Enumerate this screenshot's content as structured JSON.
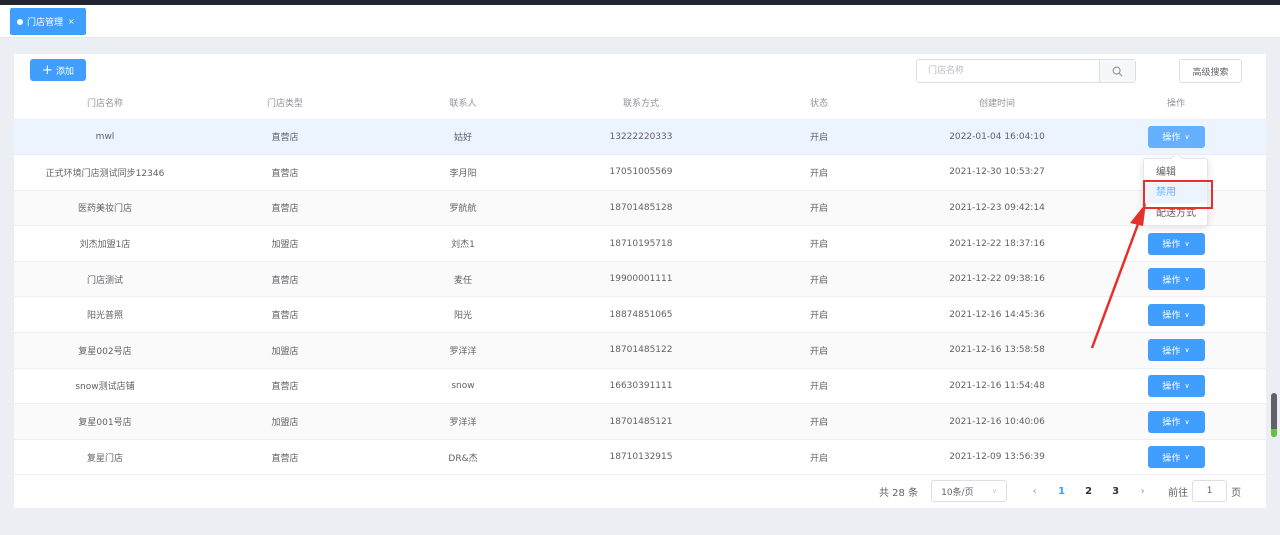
{
  "tab": {
    "label": "门店管理",
    "close": "×"
  },
  "toolbar": {
    "add_label": "添加",
    "add_icon": "+",
    "search_placeholder": "门店名称",
    "advanced_label": "高级搜索"
  },
  "table": {
    "headers": [
      "门店名称",
      "门店类型",
      "联系人",
      "联系方式",
      "状态",
      "创建时间",
      "操作"
    ],
    "action_label": "操作",
    "action_chevron": "∨",
    "rows": [
      {
        "name": "mwl",
        "type": "直营店",
        "contact": "姑好",
        "phone": "13222220333",
        "status": "开启",
        "created": "2022-01-04 16:04:10"
      },
      {
        "name": "正式环境门店测试同步12346",
        "type": "直营店",
        "contact": "李月阳",
        "phone": "17051005569",
        "status": "开启",
        "created": "2021-12-30 10:53:27"
      },
      {
        "name": "医药美妆门店",
        "type": "直营店",
        "contact": "罗航航",
        "phone": "18701485128",
        "status": "开启",
        "created": "2021-12-23 09:42:14"
      },
      {
        "name": "刘杰加盟1店",
        "type": "加盟店",
        "contact": "刘杰1",
        "phone": "18710195718",
        "status": "开启",
        "created": "2021-12-22 18:37:16"
      },
      {
        "name": "门店测试",
        "type": "直营店",
        "contact": "麦任",
        "phone": "19900001111",
        "status": "开启",
        "created": "2021-12-22 09:38:16"
      },
      {
        "name": "阳光普照",
        "type": "直营店",
        "contact": "阳光",
        "phone": "18874851065",
        "status": "开启",
        "created": "2021-12-16 14:45:36"
      },
      {
        "name": "复星002号店",
        "type": "加盟店",
        "contact": "罗洋洋",
        "phone": "18701485122",
        "status": "开启",
        "created": "2021-12-16 13:58:58"
      },
      {
        "name": "snow测试店铺",
        "type": "直营店",
        "contact": "snow",
        "phone": "16630391111",
        "status": "开启",
        "created": "2021-12-16 11:54:48"
      },
      {
        "name": "复星001号店",
        "type": "加盟店",
        "contact": "罗洋洋",
        "phone": "18701485121",
        "status": "开启",
        "created": "2021-12-16 10:40:06"
      },
      {
        "name": "复星门店",
        "type": "直营店",
        "contact": "DR&杰",
        "phone": "18710132915",
        "status": "开启",
        "created": "2021-12-09 13:56:39"
      }
    ]
  },
  "dropdown": {
    "items": [
      "编辑",
      "禁用",
      "配送方式"
    ],
    "highlighted": "禁用"
  },
  "pagination": {
    "total": "共 28 条",
    "page_size": "10条/页",
    "prev": "‹",
    "pages": [
      "1",
      "2",
      "3"
    ],
    "current": "1",
    "next": "›",
    "goto_prefix": "前往",
    "goto_value": "1",
    "goto_suffix": "页"
  },
  "colors": {
    "primary": "#409eff",
    "annotation": "#e6312a"
  },
  "icons": {
    "search": "search-icon",
    "chevron": "chevron-down-icon",
    "close": "close-icon"
  }
}
